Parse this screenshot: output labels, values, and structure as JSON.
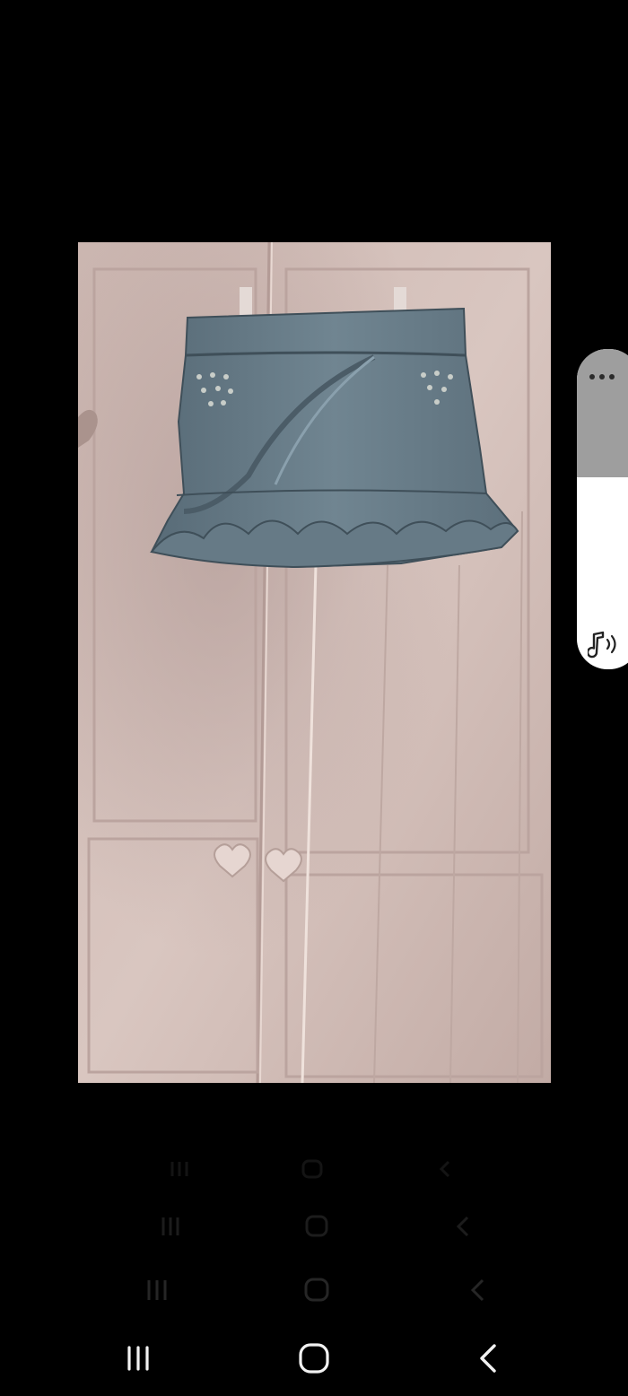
{
  "viewer": {
    "image_subject": "photo",
    "colors": {
      "background": "#000000",
      "wall": "#c9b3ad",
      "denim": "#5f7380"
    }
  },
  "volume_panel": {
    "more_icon": "more-horizontal-icon",
    "sound_icon": "sound-music-icon",
    "level": 0.6,
    "colors": {
      "fill": "#ffffff",
      "track": "#9e9e9e"
    }
  },
  "navigation": {
    "recent_icon": "recent-apps-icon",
    "home_icon": "home-icon",
    "back_icon": "back-icon"
  }
}
